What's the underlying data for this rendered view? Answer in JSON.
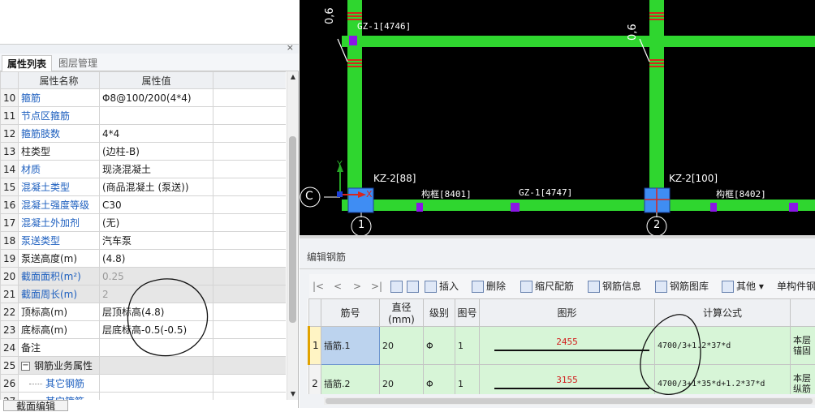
{
  "left_panel": {
    "close_glyph": "×",
    "tabs": [
      "属性列表",
      "图层管理"
    ],
    "columns": [
      "属性名称",
      "属性值"
    ],
    "rows": [
      {
        "num": "10",
        "name": "箍筋",
        "value": "Φ8@100/200(4*4)",
        "name_blue": true
      },
      {
        "num": "11",
        "name": "节点区箍筋",
        "value": "",
        "name_blue": true
      },
      {
        "num": "12",
        "name": "箍筋肢数",
        "value": "4*4",
        "name_blue": true
      },
      {
        "num": "13",
        "name": "柱类型",
        "value": "(边柱-B)",
        "name_blue": false
      },
      {
        "num": "14",
        "name": "材质",
        "value": "现浇混凝土",
        "name_blue": true
      },
      {
        "num": "15",
        "name": "混凝土类型",
        "value": "(商品混凝土 (泵送))",
        "name_blue": true
      },
      {
        "num": "16",
        "name": "混凝土强度等级",
        "value": "C30",
        "name_blue": true
      },
      {
        "num": "17",
        "name": "混凝土外加剂",
        "value": "(无)",
        "name_blue": true
      },
      {
        "num": "18",
        "name": "泵送类型",
        "value": "汽车泵",
        "name_blue": true
      },
      {
        "num": "19",
        "name": "泵送高度(m)",
        "value": "(4.8)",
        "name_blue": false
      },
      {
        "num": "20",
        "name": "截面面积(m²)",
        "value": "0.25",
        "name_blue": true,
        "shaded": true,
        "value_gray": true
      },
      {
        "num": "21",
        "name": "截面周长(m)",
        "value": "2",
        "name_blue": true,
        "shaded": true,
        "value_gray": true
      },
      {
        "num": "22",
        "name": "顶标高(m)",
        "value": "层顶标高(4.8)",
        "name_blue": false
      },
      {
        "num": "23",
        "name": "底标高(m)",
        "value": "层底标高-0.5(-0.5)",
        "name_blue": false
      },
      {
        "num": "24",
        "name": "备注",
        "value": "",
        "name_blue": false
      },
      {
        "num": "25",
        "name": "钢筋业务属性",
        "value": "",
        "name_blue": false,
        "group": true,
        "shaded": true
      },
      {
        "num": "26",
        "name": "其它钢筋",
        "value": "",
        "name_blue": true,
        "child": true
      },
      {
        "num": "27",
        "name": "其它箍筋",
        "value": "",
        "name_blue": true,
        "child": true
      }
    ],
    "bottom_button": "截面编辑"
  },
  "cad": {
    "labels": {
      "gz_top": "GZ-1[4746]",
      "dim_left": "0,6",
      "dim_right": "0,6",
      "kz_left": "KZ-2[88]",
      "kz_right": "KZ-2[100]",
      "beam1": "构框[8401]",
      "gz_bottom": "GZ-1[4747]",
      "beam2": "构框[8402]",
      "axis_c": "C",
      "axis_1": "1",
      "axis_2": "2",
      "axis_x": "X",
      "axis_y": "Y"
    },
    "colors": {
      "beam": "#2fd62f",
      "rebar": "#d8261d",
      "marker": "#8a16e6",
      "column": "#3f8df3",
      "axis": "#ffffff"
    }
  },
  "editor": {
    "title": "编辑钢筋",
    "nav": [
      "|<",
      "<",
      ">",
      ">|"
    ],
    "toolbar": {
      "insert": "插入",
      "delete": "删除",
      "scale": "缩尺配筋",
      "info": "钢筋信息",
      "library": "钢筋图库",
      "other": "其他",
      "single": "单构件钢"
    },
    "columns": [
      "",
      "筋号",
      "直径(mm)",
      "级别",
      "图号",
      "图形",
      "计算公式",
      ""
    ],
    "rows": [
      {
        "num": "1",
        "name": "插筋.1",
        "diameter": "20",
        "grade": "Φ",
        "fig": "1",
        "length": "2455",
        "formula": "4700/3+1.2*37*d",
        "desc": "本层锚固"
      },
      {
        "num": "2",
        "name": "插筋.2",
        "diameter": "20",
        "grade": "Φ",
        "fig": "1",
        "length": "3155",
        "formula": "4700/3+1*35*d+1.2*37*d",
        "desc": "本层纵筋"
      }
    ]
  }
}
